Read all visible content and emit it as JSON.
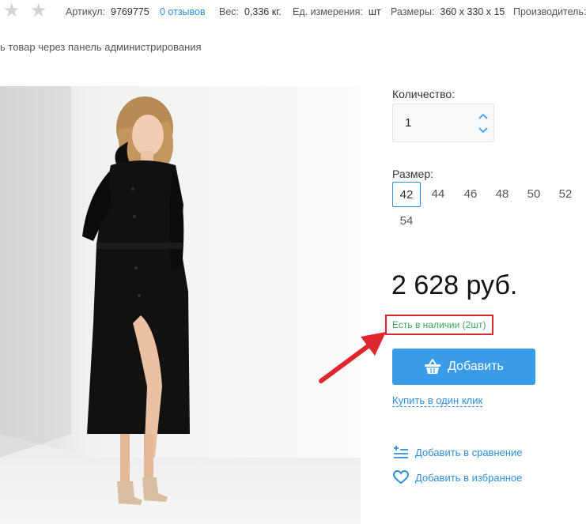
{
  "meta": {
    "article_label": "Артикул:",
    "article_value": "9769775",
    "reviews_link": "0 отзывов",
    "weight_label": "Вес:",
    "weight_value": "0,336 кг.",
    "unit_label": "Ед. измерения:",
    "unit_value": "шт",
    "size_label": "Размеры:",
    "size_value": "360 x 330 x 15",
    "manufacturer_label": "Производитель:"
  },
  "notice": "ь товар через панель администрирования",
  "quantity": {
    "label": "Количество:",
    "value": "1"
  },
  "sizes": {
    "label": "Размер:",
    "options": [
      "42",
      "44",
      "46",
      "48",
      "50",
      "52",
      "54"
    ],
    "selected": "42"
  },
  "price": "2 628 руб.",
  "stock_status": "Есть в наличии (2шт)",
  "add_button": "Добавить",
  "one_click": "Купить в один клик",
  "compare": "Добавить в сравнение",
  "favorite": "Добавить в избранное",
  "colors": {
    "accent": "#3a9be9",
    "link": "#2d8fe0",
    "in_stock": "#3aa757",
    "highlight": "#e0262d"
  }
}
